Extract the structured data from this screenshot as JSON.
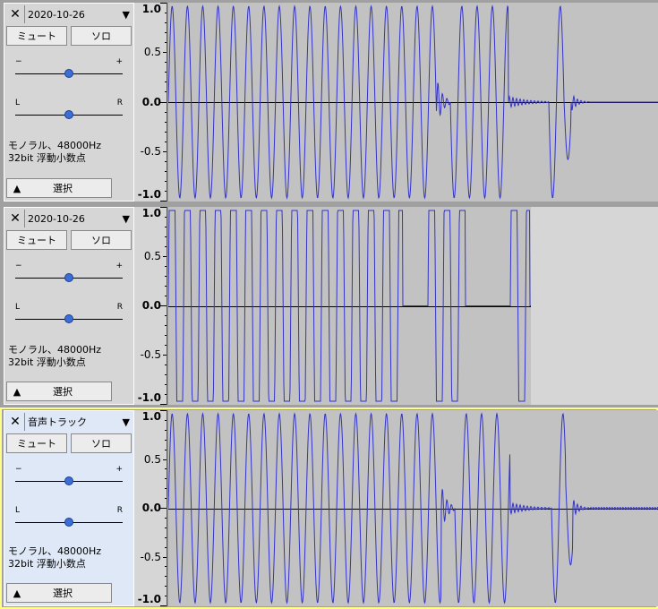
{
  "tracks": [
    {
      "name": "2020-10-26",
      "mute_label": "ミュート",
      "solo_label": "ソロ",
      "gain_minus": "−",
      "gain_plus": "+",
      "pan_left": "L",
      "pan_right": "R",
      "format_line1": "モノラル、48000Hz",
      "format_line2": "32bit 浮動小数点",
      "select_label": "選択",
      "gain_level": 0.5,
      "pan_level": 0.5,
      "scale": [
        "1.0",
        "0.5",
        "0.0",
        "-0.5",
        "-1.0"
      ],
      "selected": false
    },
    {
      "name": "2020-10-26",
      "mute_label": "ミュート",
      "solo_label": "ソロ",
      "gain_minus": "−",
      "gain_plus": "+",
      "pan_left": "L",
      "pan_right": "R",
      "format_line1": "モノラル、48000Hz",
      "format_line2": "32bit 浮動小数点",
      "select_label": "選択",
      "gain_level": 0.5,
      "pan_level": 0.5,
      "scale": [
        "1.0",
        "0.5",
        "0.0",
        "-0.5",
        "-1.0"
      ],
      "selected": false
    },
    {
      "name": "音声トラック",
      "mute_label": "ミュート",
      "solo_label": "ソロ",
      "gain_minus": "−",
      "gain_plus": "+",
      "pan_left": "L",
      "pan_right": "R",
      "format_line1": "モノラル、48000Hz",
      "format_line2": "32bit 浮動小数点",
      "select_label": "選択",
      "gain_level": 0.5,
      "pan_level": 0.5,
      "scale": [
        "1.0",
        "0.5",
        "0.0",
        "-0.5",
        "-1.0"
      ],
      "selected": true
    }
  ],
  "colors": {
    "waveform": "#3333cc",
    "selected_outline": "#ffff88"
  },
  "icons": {
    "close": "close-icon",
    "dropdown": "triangle-down-icon",
    "collapse": "triangle-up-icon"
  }
}
